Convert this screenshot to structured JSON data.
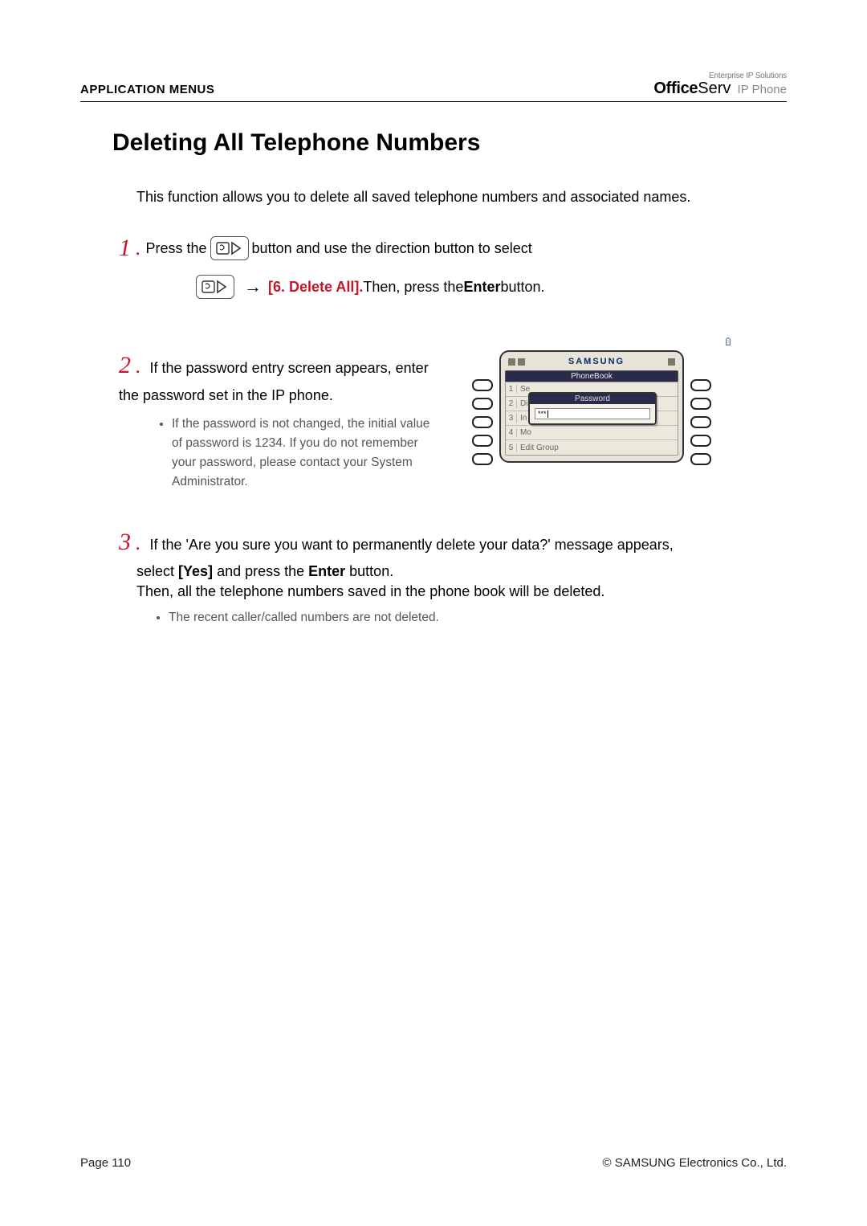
{
  "header": {
    "section": "APPLICATION MENUS",
    "brand_sup": "Enterprise IP Solutions",
    "brand_office": "Office",
    "brand_serv": "Serv",
    "brand_ip": " IP Phone"
  },
  "title": "Deleting All Telephone Numbers",
  "intro": "This function allows you to delete all saved telephone numbers and associated names.",
  "step1": {
    "num": "1",
    "dot": ".",
    "press_the": " Press the ",
    "after_btn": " button and use the direction button to select",
    "arrow": "→",
    "menu_label": "[6. Delete All].",
    "then_press": "  Then, press the ",
    "enter": "Enter",
    "button_period": " button."
  },
  "step2": {
    "num": "2",
    "dot": ".",
    "line": " If the password entry screen appears, enter the password set in the IP phone.",
    "note": "If the password is not changed, the initial value of password is 1234. If you do not remember your password, please contact your System Administrator."
  },
  "device": {
    "brand": "SAMSUNG",
    "phonebook": "PhoneBook",
    "rows": [
      {
        "n": "1",
        "t": "Se"
      },
      {
        "n": "2",
        "t": "Di"
      },
      {
        "n": "3",
        "t": "In"
      },
      {
        "n": "4",
        "t": "Mo"
      },
      {
        "n": "5",
        "t": "Edit Group"
      }
    ],
    "pw_title": "Password",
    "pw_masked": "***"
  },
  "step3": {
    "num": "3",
    "dot": ".",
    "line_a": " If the 'Are you sure you want to permanently delete your data?' message appears,",
    "line_b_pre": "select ",
    "yes": "[Yes]",
    "line_b_mid": " and press the ",
    "enter": "Enter",
    "line_b_post": " button.",
    "line_c": "Then, all the telephone numbers saved in the phone book will be deleted.",
    "note": "The recent caller/called numbers are not deleted."
  },
  "footer": {
    "page": "Page 110",
    "copyright": "© SAMSUNG Electronics Co., Ltd."
  }
}
